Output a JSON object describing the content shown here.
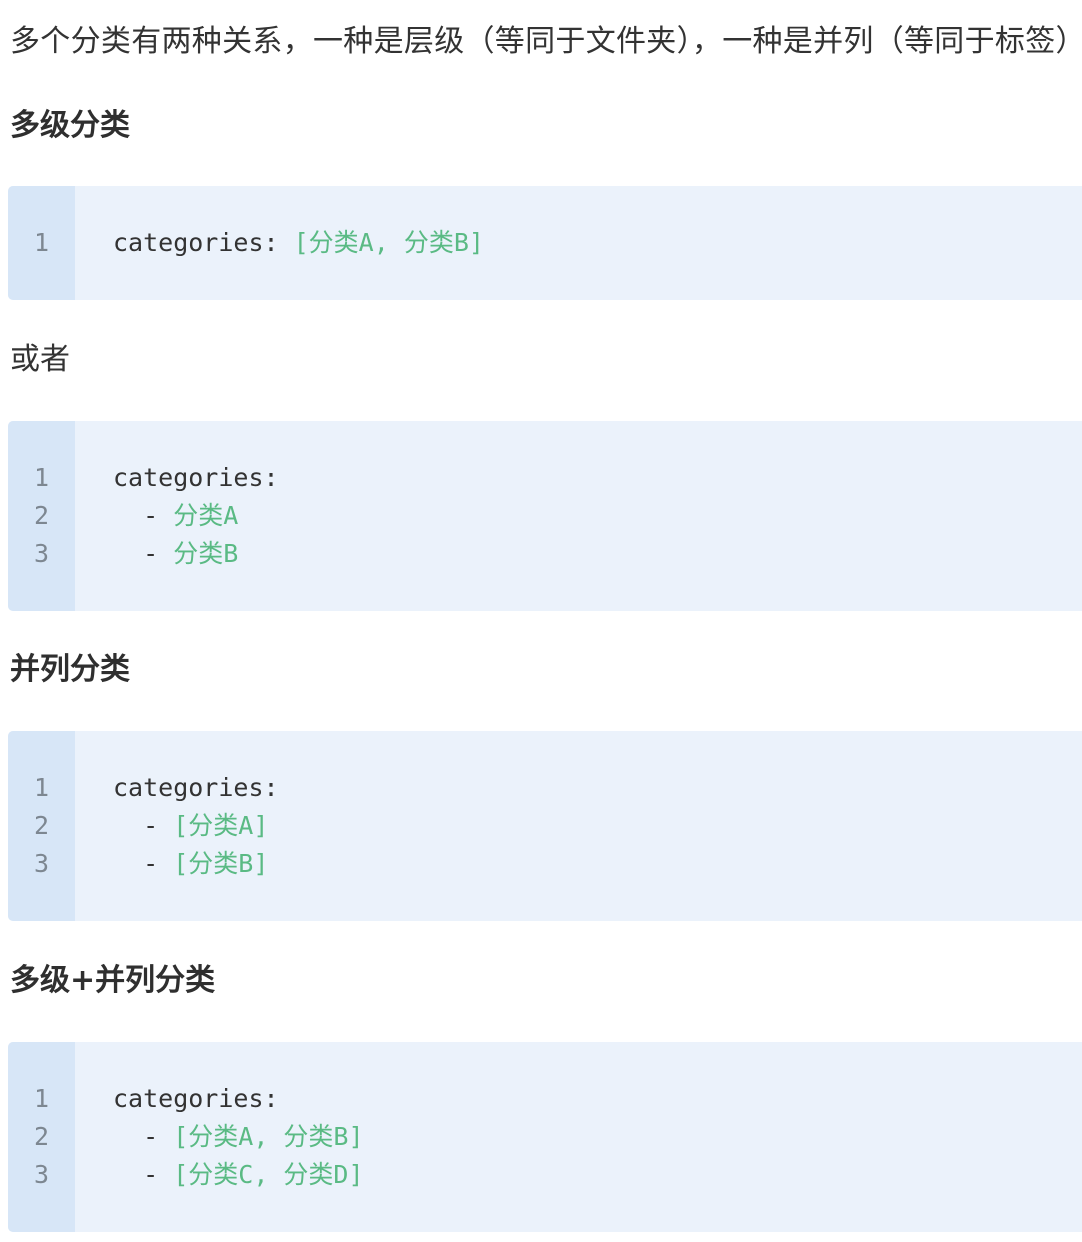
{
  "intro_text": "多个分类有两种关系，一种是层级（等同于文件夹），一种是并列（等同于标签）",
  "sections": [
    {
      "heading": "多级分类",
      "code_lines": [
        {
          "number": "1",
          "key": "categories:",
          "value": " [分类A, 分类B]"
        }
      ]
    },
    {
      "note": "或者",
      "code_lines": [
        {
          "number": "1",
          "key": "categories:",
          "value": ""
        },
        {
          "number": "2",
          "key": "  - ",
          "value": "分类A"
        },
        {
          "number": "3",
          "key": "  - ",
          "value": "分类B"
        }
      ]
    },
    {
      "heading": "并列分类",
      "code_lines": [
        {
          "number": "1",
          "key": "categories:",
          "value": ""
        },
        {
          "number": "2",
          "key": "  - ",
          "value": "[分类A]"
        },
        {
          "number": "3",
          "key": "  - ",
          "value": "[分类B]"
        }
      ]
    },
    {
      "heading": "多级+并列分类",
      "code_lines": [
        {
          "number": "1",
          "key": "categories:",
          "value": ""
        },
        {
          "number": "2",
          "key": "  - ",
          "value": "[分类A, 分类B]"
        },
        {
          "number": "3",
          "key": "  - ",
          "value": "[分类C, 分类D]"
        }
      ]
    }
  ],
  "colors": {
    "code_background": "#ebf2fb",
    "gutter_background": "#d7e6f7",
    "string_value": "#5aba84",
    "text": "#333333"
  }
}
